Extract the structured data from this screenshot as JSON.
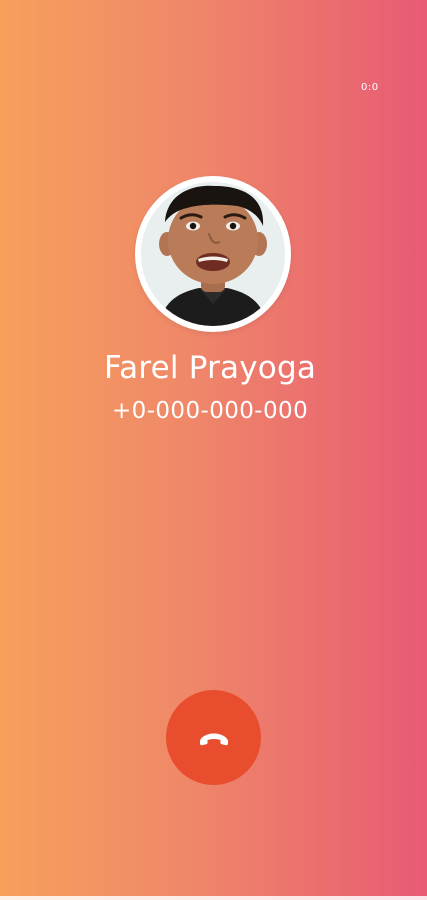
{
  "call": {
    "timer": "0:0",
    "contact_name": "Farel Prayoga",
    "contact_number": "+0-000-000-000"
  },
  "icons": {
    "end_call": "phone-hangup-icon",
    "avatar": "contact-avatar-photo"
  },
  "colors": {
    "background_left": "#f6a05c",
    "background_mid": "#ef8769",
    "background_right": "#e85a74",
    "end_call_button": "#e84d2e",
    "text": "#ffffff"
  }
}
